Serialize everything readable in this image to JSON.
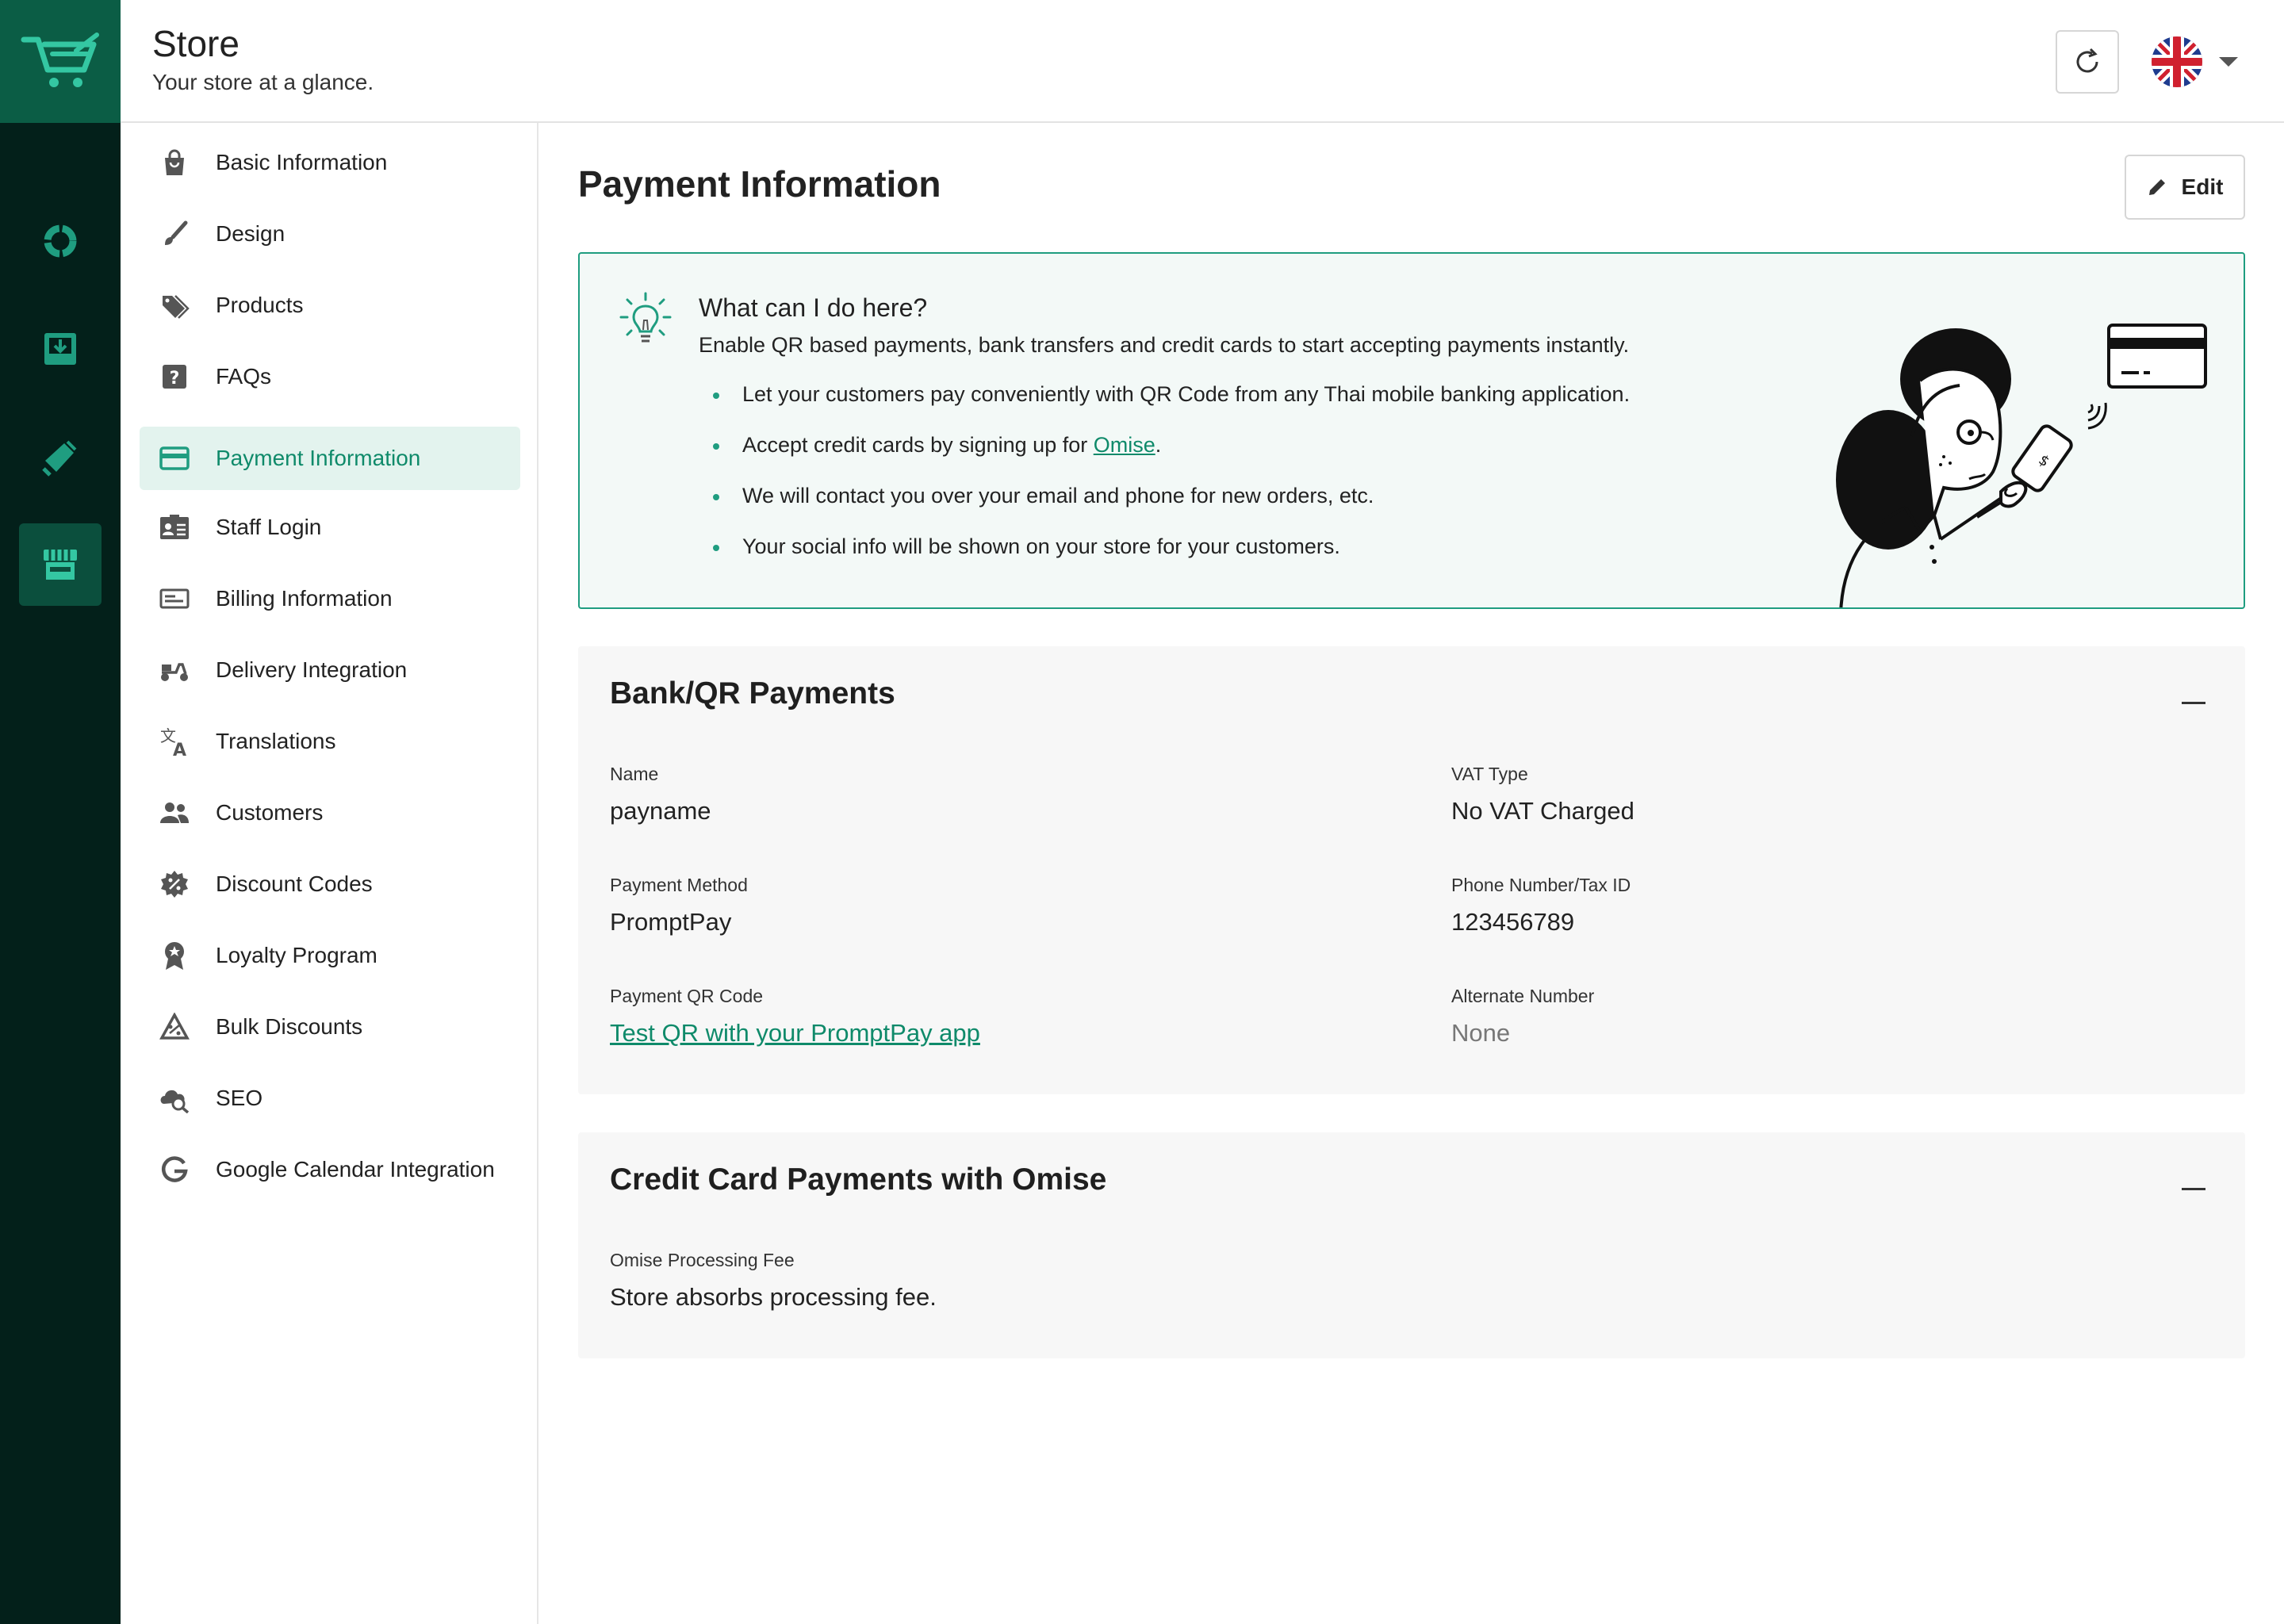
{
  "header": {
    "title": "Store",
    "subtitle": "Your store at a glance."
  },
  "rail": {
    "items": [
      {
        "icon": "dashboard-icon"
      },
      {
        "icon": "orders-icon"
      },
      {
        "icon": "marketing-icon"
      },
      {
        "icon": "store-icon",
        "active": true
      }
    ]
  },
  "sidenav": {
    "items": [
      {
        "label": "Basic Information",
        "icon": "shopping-bag-icon"
      },
      {
        "label": "Design",
        "icon": "brush-icon"
      },
      {
        "label": "Products",
        "icon": "tags-icon"
      },
      {
        "label": "FAQs",
        "icon": "question-icon"
      },
      {
        "label": "Payment Information",
        "icon": "credit-card-icon",
        "active": true
      },
      {
        "label": "Staff Login",
        "icon": "id-card-icon"
      },
      {
        "label": "Billing Information",
        "icon": "billing-icon"
      },
      {
        "label": "Delivery Integration",
        "icon": "scooter-icon"
      },
      {
        "label": "Translations",
        "icon": "translate-icon"
      },
      {
        "label": "Customers",
        "icon": "people-icon"
      },
      {
        "label": "Discount Codes",
        "icon": "discount-icon"
      },
      {
        "label": "Loyalty Program",
        "icon": "award-icon"
      },
      {
        "label": "Bulk Discounts",
        "icon": "bulk-discount-icon"
      },
      {
        "label": "SEO",
        "icon": "seo-icon"
      },
      {
        "label": "Google Calendar Integration",
        "icon": "google-icon"
      }
    ]
  },
  "main": {
    "title": "Payment Information",
    "edit_label": "Edit"
  },
  "help": {
    "title": "What can I do here?",
    "description": "Enable QR based payments, bank transfers and credit cards to start accepting payments instantly.",
    "bullets": [
      "Let your customers pay conveniently with QR Code from any Thai mobile banking application.",
      "Accept credit cards by signing up for ",
      "We will contact you over your email and phone for new orders, etc.",
      "Your social info will be shown on your store for your customers."
    ],
    "omise_link": "Omise",
    "bullet_2_suffix": "."
  },
  "bank": {
    "title": "Bank/QR Payments",
    "name_label": "Name",
    "name_value": "payname",
    "vat_label": "VAT Type",
    "vat_value": "No VAT Charged",
    "method_label": "Payment Method",
    "method_value": "PromptPay",
    "phone_label": "Phone Number/Tax ID",
    "phone_value": "123456789",
    "qr_label": "Payment QR Code",
    "qr_link": "Test QR with your PromptPay app",
    "alt_label": "Alternate Number",
    "alt_value": "None"
  },
  "credit": {
    "title": "Credit Card Payments with Omise",
    "fee_label": "Omise Processing Fee",
    "fee_value": "Store absorbs processing fee."
  },
  "colors": {
    "rail_bg": "#03201a",
    "logo_bg": "#0b5d45",
    "accent": "#1f9d80",
    "active_bg": "#e3f3ee"
  }
}
